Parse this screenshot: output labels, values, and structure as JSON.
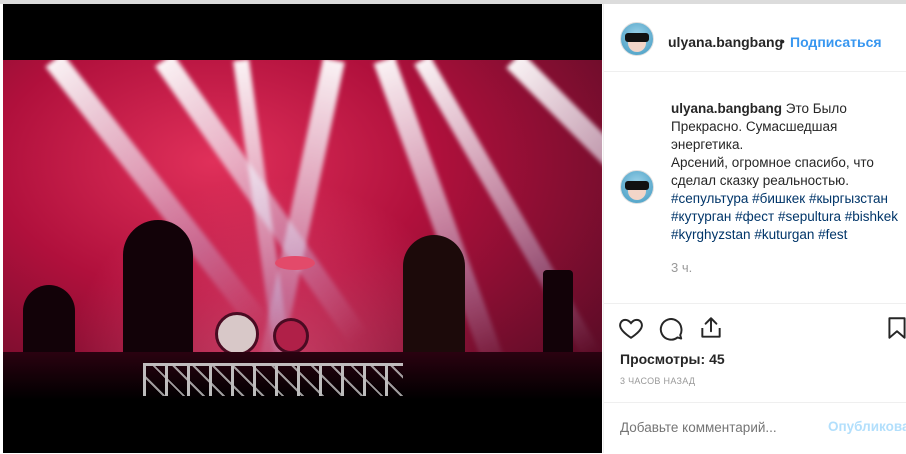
{
  "post": {
    "username": "ulyana.bangbang",
    "dot": "•",
    "follow_label": "Подписаться",
    "caption_user": "ulyana.bangbang",
    "caption_line1": "Это Было Прекрасно. Сумасшедшая энергетика.",
    "caption_line2": "Арсений, огромное спасибо, что сделал сказку реальностью.",
    "hashtags": [
      "#сепультура",
      "#бишкек",
      "#кыргызстан",
      "#кутурган",
      "#фест",
      "#sepultura",
      "#bishkek",
      "#kyrghyzstan",
      "#kuturgan",
      "#fest"
    ],
    "comment_time": "3 ч.",
    "views_label": "Просмотры:",
    "views_count": "45",
    "posted_ago": "3 ЧАСОВ НАЗАД",
    "add_comment_placeholder": "Добавьте комментарий...",
    "publish_label": "Опубликовать"
  },
  "icons": {
    "like": "heart-outline-icon",
    "comment": "speech-bubble-icon",
    "share": "share-icon",
    "save": "bookmark-icon"
  },
  "colors": {
    "link_blue": "#3897f0",
    "hashtag": "#003569",
    "muted": "#999999",
    "publish_disabled": "#b2dffc"
  }
}
